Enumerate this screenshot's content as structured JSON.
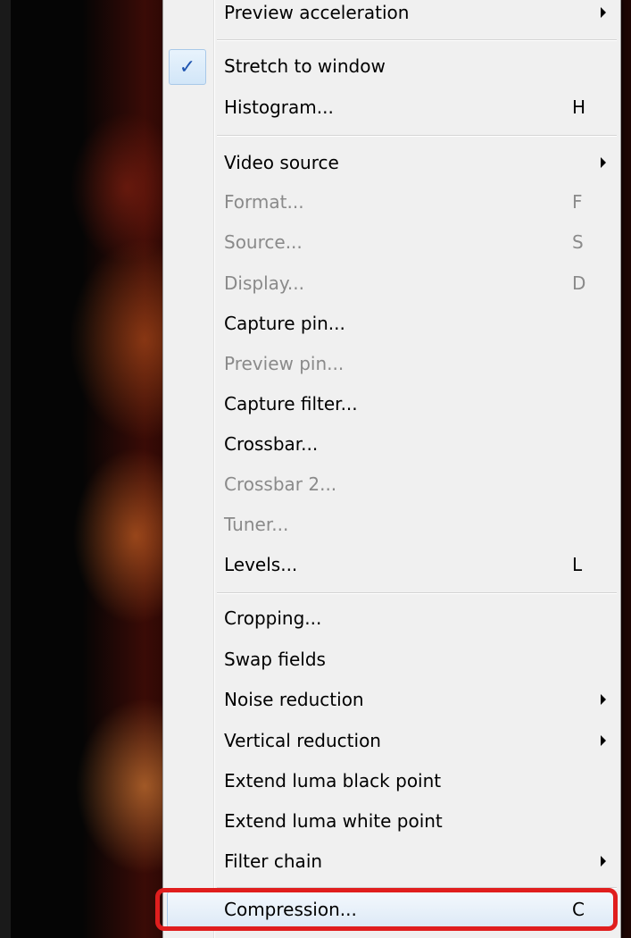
{
  "menu": {
    "items": [
      {
        "label": "Preview acceleration",
        "shortcut": "",
        "submenu": true,
        "disabled": false,
        "checked": false
      },
      {
        "label": "Stretch to window",
        "shortcut": "",
        "submenu": false,
        "disabled": false,
        "checked": true
      },
      {
        "label": "Histogram...",
        "shortcut": "H",
        "submenu": false,
        "disabled": false,
        "checked": false
      },
      {
        "label": "Video source",
        "shortcut": "",
        "submenu": true,
        "disabled": false,
        "checked": false
      },
      {
        "label": "Format...",
        "shortcut": "F",
        "submenu": false,
        "disabled": true,
        "checked": false
      },
      {
        "label": "Source...",
        "shortcut": "S",
        "submenu": false,
        "disabled": true,
        "checked": false
      },
      {
        "label": "Display...",
        "shortcut": "D",
        "submenu": false,
        "disabled": true,
        "checked": false
      },
      {
        "label": "Capture pin...",
        "shortcut": "",
        "submenu": false,
        "disabled": false,
        "checked": false
      },
      {
        "label": "Preview pin...",
        "shortcut": "",
        "submenu": false,
        "disabled": true,
        "checked": false
      },
      {
        "label": "Capture filter...",
        "shortcut": "",
        "submenu": false,
        "disabled": false,
        "checked": false
      },
      {
        "label": "Crossbar...",
        "shortcut": "",
        "submenu": false,
        "disabled": false,
        "checked": false
      },
      {
        "label": "Crossbar 2...",
        "shortcut": "",
        "submenu": false,
        "disabled": true,
        "checked": false
      },
      {
        "label": "Tuner...",
        "shortcut": "",
        "submenu": false,
        "disabled": true,
        "checked": false
      },
      {
        "label": "Levels...",
        "shortcut": "L",
        "submenu": false,
        "disabled": false,
        "checked": false
      },
      {
        "label": "Cropping...",
        "shortcut": "",
        "submenu": false,
        "disabled": false,
        "checked": false
      },
      {
        "label": "Swap fields",
        "shortcut": "",
        "submenu": false,
        "disabled": false,
        "checked": false
      },
      {
        "label": "Noise reduction",
        "shortcut": "",
        "submenu": true,
        "disabled": false,
        "checked": false
      },
      {
        "label": "Vertical reduction",
        "shortcut": "",
        "submenu": true,
        "disabled": false,
        "checked": false
      },
      {
        "label": "Extend luma black point",
        "shortcut": "",
        "submenu": false,
        "disabled": false,
        "checked": false
      },
      {
        "label": "Extend luma white point",
        "shortcut": "",
        "submenu": false,
        "disabled": false,
        "checked": false
      },
      {
        "label": "Filter chain",
        "shortcut": "",
        "submenu": true,
        "disabled": false,
        "checked": false
      },
      {
        "label": "Compression...",
        "shortcut": "C",
        "submenu": false,
        "disabled": false,
        "checked": false,
        "highlighted": true
      }
    ],
    "check_glyph": "✓"
  },
  "colors": {
    "menu_bg": "#f0f0f0",
    "disabled_text": "#8a8a8a",
    "highlight_border": "#a8c8e8",
    "annotation_red": "#e01e1e"
  }
}
